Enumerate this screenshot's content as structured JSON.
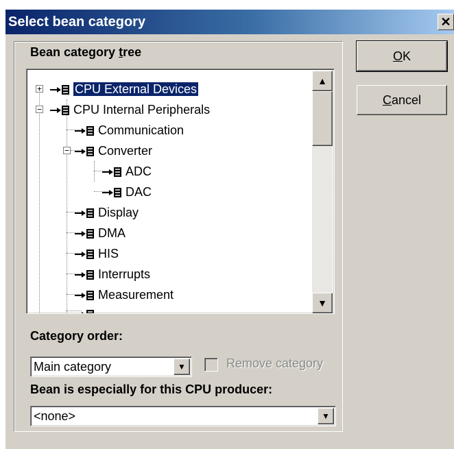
{
  "window": {
    "title": "Select bean category",
    "close_glyph": "✕"
  },
  "tree_section": {
    "label_prefix": "Bean category ",
    "label_access": "t",
    "label_suffix": "ree"
  },
  "tree": {
    "items": [
      {
        "label": "CPU External Devices",
        "expander": "+",
        "selected": true
      },
      {
        "label": "CPU Internal Peripherals",
        "expander": "−"
      },
      {
        "label": "Communication"
      },
      {
        "label": "Converter",
        "expander": "−"
      },
      {
        "label": "ADC"
      },
      {
        "label": "DAC"
      },
      {
        "label": "Display"
      },
      {
        "label": "DMA"
      },
      {
        "label": "HIS"
      },
      {
        "label": "Interrupts"
      },
      {
        "label": "Measurement"
      }
    ],
    "icon": "bean-category-icon"
  },
  "scrollbar": {
    "up_glyph": "▲",
    "down_glyph": "▼"
  },
  "buttons": {
    "ok_access": "O",
    "ok_rest": "K",
    "cancel_access": "C",
    "cancel_rest": "ancel"
  },
  "category_order": {
    "label": "Category order:",
    "selected": "Main category",
    "remove_label": "Remove category",
    "remove_checked": false,
    "remove_enabled": false
  },
  "producer": {
    "label": "Bean is especially for this CPU producer:",
    "selected": "<none>"
  },
  "colors": {
    "face": "#d4d0c8",
    "title_start": "#0a246a",
    "title_end": "#a6caf0",
    "selection": "#0a246a"
  }
}
